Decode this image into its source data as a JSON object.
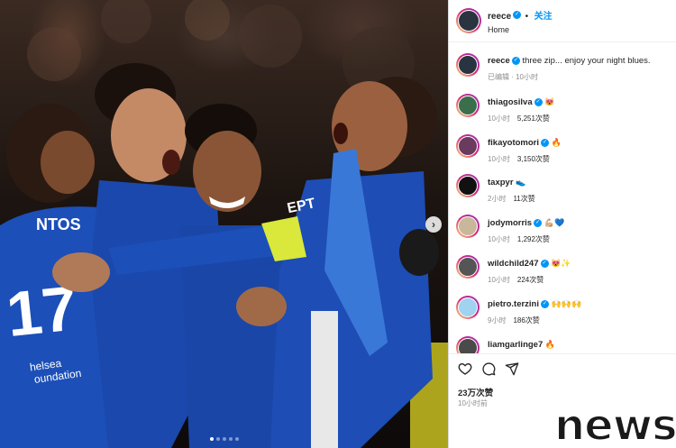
{
  "header": {
    "username": "reece",
    "follow_label": "关注",
    "location": "Home"
  },
  "caption": {
    "username": "reece",
    "text": "three zip... enjoy your night blues.",
    "meta": "已编辑 · 10小时"
  },
  "comments": [
    {
      "username": "thiagosilva",
      "verified": true,
      "text": "😻",
      "time": "10小时",
      "likes": "5,251次赞",
      "avatar_color": "#3b6e4a"
    },
    {
      "username": "fikayotomori",
      "verified": true,
      "text": "🔥",
      "time": "10小时",
      "likes": "3,150次赞",
      "avatar_color": "#6a3b5e"
    },
    {
      "username": "taxpyr",
      "verified": false,
      "text": "👟",
      "time": "2小时",
      "likes": "11次赞",
      "avatar_color": "#111111"
    },
    {
      "username": "jodymorris",
      "verified": true,
      "text": "💪🏼💙",
      "time": "10小时",
      "likes": "1,292次赞",
      "avatar_color": "#c9b79c"
    },
    {
      "username": "wildchild247",
      "verified": true,
      "text": "😻✨",
      "time": "10小时",
      "likes": "224次赞",
      "avatar_color": "#555555"
    },
    {
      "username": "pietro.terzini",
      "verified": true,
      "text": "🙌🙌🙌",
      "time": "9小时",
      "likes": "186次赞",
      "avatar_color": "#9fd3f0"
    },
    {
      "username": "liamgarlinge7",
      "verified": false,
      "text": "🔥",
      "time": "",
      "likes": "",
      "avatar_color": "#4a4a4a"
    }
  ],
  "actions": {
    "like_icon": "heart-icon",
    "comment_icon": "comment-icon",
    "share_icon": "paper-plane-icon"
  },
  "post_stats": {
    "likes": "23万次赞",
    "time": "10小时前"
  },
  "carousel": {
    "total_slides": 5,
    "active_index": 0
  },
  "watermark": "news",
  "colors": {
    "brand_blue": "#0095f6",
    "jersey_blue": "#1c4fb8"
  }
}
